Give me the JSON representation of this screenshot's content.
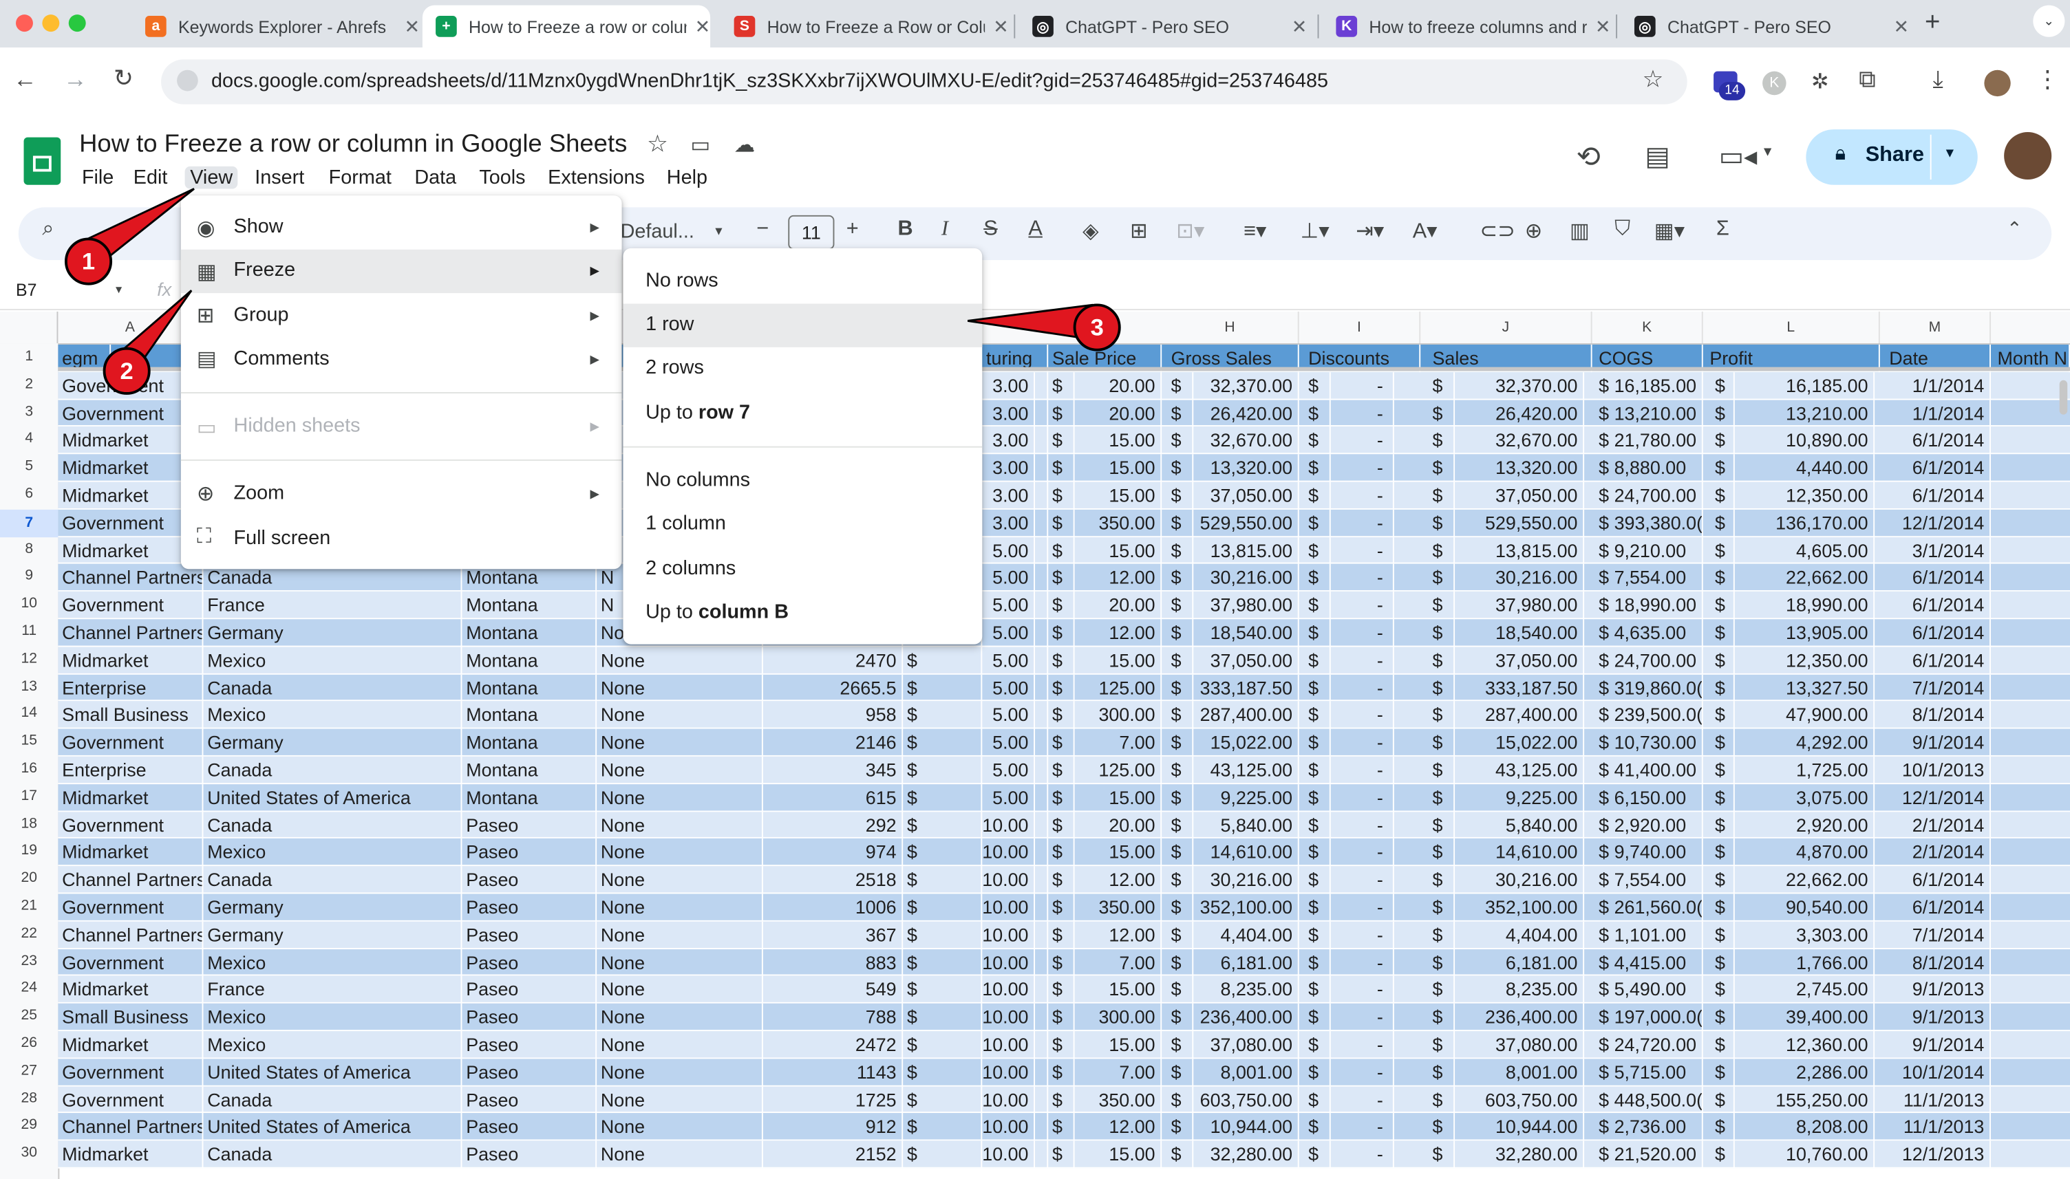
{
  "browser": {
    "tabs": [
      {
        "title": "Keywords Explorer - Ahrefs",
        "fav": "a",
        "fav_color": "#f26f21"
      },
      {
        "title": "How to Freeze a row or column",
        "fav": "+",
        "fav_color": "#0f9d58"
      },
      {
        "title": "How to Freeze a Row or Column",
        "fav": "S",
        "fav_color": "#e0352b"
      },
      {
        "title": "ChatGPT - Pero SEO",
        "fav": "◎",
        "fav_color": "#202124"
      },
      {
        "title": "How to freeze columns and rows",
        "fav": "K",
        "fav_color": "#6b3fd4"
      },
      {
        "title": "ChatGPT - Pero SEO",
        "fav": "◎",
        "fav_color": "#202124"
      }
    ],
    "url": "docs.google.com/spreadsheets/d/11Mznx0ygdWnenDhr1tjK_sz3SKXxbr7ijXWOUlMXU-E/edit?gid=253746485#gid=253746485",
    "extension_badge": "14"
  },
  "sheets": {
    "doc_title": "How to Freeze a row or column in Google Sheets",
    "menu": [
      "File",
      "Edit",
      "View",
      "Insert",
      "Format",
      "Data",
      "Tools",
      "Extensions",
      "Help"
    ],
    "share_label": "Share",
    "font_name": "Defaul...",
    "font_size": "11",
    "name_box": "B7",
    "fx": "fx"
  },
  "view_menu": {
    "items": [
      "Show",
      "Freeze",
      "Group",
      "Comments",
      "Hidden sheets",
      "Zoom",
      "Full screen"
    ]
  },
  "freeze_submenu": {
    "rows": [
      "No rows",
      "1 row",
      "2 rows",
      "Up to"
    ],
    "row_bold": "row 7",
    "cols": [
      "No columns",
      "1 column",
      "2 columns",
      "Up to"
    ],
    "col_bold": "column B"
  },
  "annotations": [
    "1",
    "2",
    "3"
  ],
  "grid": {
    "columns": [
      "A",
      "H",
      "I",
      "J",
      "K",
      "L",
      "M"
    ],
    "header_row": [
      "egm",
      "turing",
      "Sale Price",
      "Gross Sales",
      "Discounts",
      "Sales",
      "COGS",
      "Profit",
      "Date",
      "Month N"
    ],
    "rows": [
      {
        "n": "1"
      },
      {
        "n": "2",
        "seg": "Government",
        "country": "",
        "product": "",
        "disc": "",
        "units": "",
        "mfg": "3.00",
        "price": "20.00",
        "gross": "32,370.00",
        "sales": "32,370.00",
        "cogs": "$ 16,185.00",
        "profit": "16,185.00",
        "date": "1/1/2014"
      },
      {
        "n": "3",
        "seg": "Government",
        "country": "",
        "product": "",
        "disc": "",
        "units": "",
        "mfg": "3.00",
        "price": "20.00",
        "gross": "26,420.00",
        "sales": "26,420.00",
        "cogs": "$ 13,210.00",
        "profit": "13,210.00",
        "date": "1/1/2014"
      },
      {
        "n": "4",
        "seg": "Midmarket",
        "country": "",
        "product": "",
        "disc": "",
        "units": "",
        "mfg": "3.00",
        "price": "15.00",
        "gross": "32,670.00",
        "sales": "32,670.00",
        "cogs": "$ 21,780.00",
        "profit": "10,890.00",
        "date": "6/1/2014"
      },
      {
        "n": "5",
        "seg": "Midmarket",
        "country": "",
        "product": "",
        "disc": "",
        "units": "",
        "mfg": "3.00",
        "price": "15.00",
        "gross": "13,320.00",
        "sales": "13,320.00",
        "cogs": "$ 8,880.00",
        "profit": "4,440.00",
        "date": "6/1/2014"
      },
      {
        "n": "6",
        "seg": "Midmarket",
        "country": "",
        "product": "",
        "disc": "",
        "units": "",
        "mfg": "3.00",
        "price": "15.00",
        "gross": "37,050.00",
        "sales": "37,050.00",
        "cogs": "$ 24,700.00",
        "profit": "12,350.00",
        "date": "6/1/2014"
      },
      {
        "n": "7",
        "seg": "Government",
        "country": "",
        "product": "",
        "disc": "",
        "units": "",
        "mfg": "3.00",
        "price": "350.00",
        "gross": "529,550.00",
        "sales": "529,550.00",
        "cogs": "$ 393,380.0(",
        "profit": "136,170.00",
        "date": "12/1/2014"
      },
      {
        "n": "8",
        "seg": "Midmarket",
        "country": "",
        "product": "",
        "disc": "",
        "units": "",
        "mfg": "5.00",
        "price": "15.00",
        "gross": "13,815.00",
        "sales": "13,815.00",
        "cogs": "$ 9,210.00",
        "profit": "4,605.00",
        "date": "3/1/2014"
      },
      {
        "n": "9",
        "seg": "Channel Partners",
        "country": "Canada",
        "product": "Montana",
        "disc": "N",
        "units": "",
        "mfg": "5.00",
        "price": "12.00",
        "gross": "30,216.00",
        "sales": "30,216.00",
        "cogs": "$ 7,554.00",
        "profit": "22,662.00",
        "date": "6/1/2014"
      },
      {
        "n": "10",
        "seg": "Government",
        "country": "France",
        "product": "Montana",
        "disc": "N",
        "units": "",
        "mfg": "5.00",
        "price": "20.00",
        "gross": "37,980.00",
        "sales": "37,980.00",
        "cogs": "$ 18,990.00",
        "profit": "18,990.00",
        "date": "6/1/2014"
      },
      {
        "n": "11",
        "seg": "Channel Partners",
        "country": "Germany",
        "product": "Montana",
        "disc": "None",
        "units": "",
        "mfg": "5.00",
        "price": "12.00",
        "gross": "18,540.00",
        "sales": "18,540.00",
        "cogs": "$ 4,635.00",
        "profit": "13,905.00",
        "date": "6/1/2014"
      },
      {
        "n": "12",
        "seg": "Midmarket",
        "country": "Mexico",
        "product": "Montana",
        "disc": "None",
        "units": "2470",
        "mfg": "5.00",
        "price": "15.00",
        "gross": "37,050.00",
        "sales": "37,050.00",
        "cogs": "$ 24,700.00",
        "profit": "12,350.00",
        "date": "6/1/2014"
      },
      {
        "n": "13",
        "seg": "Enterprise",
        "country": "Canada",
        "product": "Montana",
        "disc": "None",
        "units": "2665.5",
        "mfg": "5.00",
        "price": "125.00",
        "gross": "333,187.50",
        "sales": "333,187.50",
        "cogs": "$ 319,860.0(",
        "profit": "13,327.50",
        "date": "7/1/2014"
      },
      {
        "n": "14",
        "seg": "Small Business",
        "country": "Mexico",
        "product": "Montana",
        "disc": "None",
        "units": "958",
        "mfg": "5.00",
        "price": "300.00",
        "gross": "287,400.00",
        "sales": "287,400.00",
        "cogs": "$ 239,500.0(",
        "profit": "47,900.00",
        "date": "8/1/2014"
      },
      {
        "n": "15",
        "seg": "Government",
        "country": "Germany",
        "product": "Montana",
        "disc": "None",
        "units": "2146",
        "mfg": "5.00",
        "price": "7.00",
        "gross": "15,022.00",
        "sales": "15,022.00",
        "cogs": "$ 10,730.00",
        "profit": "4,292.00",
        "date": "9/1/2014"
      },
      {
        "n": "16",
        "seg": "Enterprise",
        "country": "Canada",
        "product": "Montana",
        "disc": "None",
        "units": "345",
        "mfg": "5.00",
        "price": "125.00",
        "gross": "43,125.00",
        "sales": "43,125.00",
        "cogs": "$ 41,400.00",
        "profit": "1,725.00",
        "date": "10/1/2013"
      },
      {
        "n": "17",
        "seg": "Midmarket",
        "country": "United States of America",
        "product": "Montana",
        "disc": "None",
        "units": "615",
        "mfg": "5.00",
        "price": "15.00",
        "gross": "9,225.00",
        "sales": "9,225.00",
        "cogs": "$ 6,150.00",
        "profit": "3,075.00",
        "date": "12/1/2014"
      },
      {
        "n": "18",
        "seg": "Government",
        "country": "Canada",
        "product": "Paseo",
        "disc": "None",
        "units": "292",
        "mfg": "10.00",
        "price": "20.00",
        "gross": "5,840.00",
        "sales": "5,840.00",
        "cogs": "$ 2,920.00",
        "profit": "2,920.00",
        "date": "2/1/2014"
      },
      {
        "n": "19",
        "seg": "Midmarket",
        "country": "Mexico",
        "product": "Paseo",
        "disc": "None",
        "units": "974",
        "mfg": "10.00",
        "price": "15.00",
        "gross": "14,610.00",
        "sales": "14,610.00",
        "cogs": "$ 9,740.00",
        "profit": "4,870.00",
        "date": "2/1/2014"
      },
      {
        "n": "20",
        "seg": "Channel Partners",
        "country": "Canada",
        "product": "Paseo",
        "disc": "None",
        "units": "2518",
        "mfg": "10.00",
        "price": "12.00",
        "gross": "30,216.00",
        "sales": "30,216.00",
        "cogs": "$ 7,554.00",
        "profit": "22,662.00",
        "date": "6/1/2014"
      },
      {
        "n": "21",
        "seg": "Government",
        "country": "Germany",
        "product": "Paseo",
        "disc": "None",
        "units": "1006",
        "mfg": "10.00",
        "price": "350.00",
        "gross": "352,100.00",
        "sales": "352,100.00",
        "cogs": "$ 261,560.0(",
        "profit": "90,540.00",
        "date": "6/1/2014"
      },
      {
        "n": "22",
        "seg": "Channel Partners",
        "country": "Germany",
        "product": "Paseo",
        "disc": "None",
        "units": "367",
        "mfg": "10.00",
        "price": "12.00",
        "gross": "4,404.00",
        "sales": "4,404.00",
        "cogs": "$ 1,101.00",
        "profit": "3,303.00",
        "date": "7/1/2014"
      },
      {
        "n": "23",
        "seg": "Government",
        "country": "Mexico",
        "product": "Paseo",
        "disc": "None",
        "units": "883",
        "mfg": "10.00",
        "price": "7.00",
        "gross": "6,181.00",
        "sales": "6,181.00",
        "cogs": "$ 4,415.00",
        "profit": "1,766.00",
        "date": "8/1/2014"
      },
      {
        "n": "24",
        "seg": "Midmarket",
        "country": "France",
        "product": "Paseo",
        "disc": "None",
        "units": "549",
        "mfg": "10.00",
        "price": "15.00",
        "gross": "8,235.00",
        "sales": "8,235.00",
        "cogs": "$ 5,490.00",
        "profit": "2,745.00",
        "date": "9/1/2013"
      },
      {
        "n": "25",
        "seg": "Small Business",
        "country": "Mexico",
        "product": "Paseo",
        "disc": "None",
        "units": "788",
        "mfg": "10.00",
        "price": "300.00",
        "gross": "236,400.00",
        "sales": "236,400.00",
        "cogs": "$ 197,000.0(",
        "profit": "39,400.00",
        "date": "9/1/2013"
      },
      {
        "n": "26",
        "seg": "Midmarket",
        "country": "Mexico",
        "product": "Paseo",
        "disc": "None",
        "units": "2472",
        "mfg": "10.00",
        "price": "15.00",
        "gross": "37,080.00",
        "sales": "37,080.00",
        "cogs": "$ 24,720.00",
        "profit": "12,360.00",
        "date": "9/1/2014"
      },
      {
        "n": "27",
        "seg": "Government",
        "country": "United States of America",
        "product": "Paseo",
        "disc": "None",
        "units": "1143",
        "mfg": "10.00",
        "price": "7.00",
        "gross": "8,001.00",
        "sales": "8,001.00",
        "cogs": "$ 5,715.00",
        "profit": "2,286.00",
        "date": "10/1/2014"
      },
      {
        "n": "28",
        "seg": "Government",
        "country": "Canada",
        "product": "Paseo",
        "disc": "None",
        "units": "1725",
        "mfg": "10.00",
        "price": "350.00",
        "gross": "603,750.00",
        "sales": "603,750.00",
        "cogs": "$ 448,500.0(",
        "profit": "155,250.00",
        "date": "11/1/2013"
      },
      {
        "n": "29",
        "seg": "Channel Partners",
        "country": "United States of America",
        "product": "Paseo",
        "disc": "None",
        "units": "912",
        "mfg": "10.00",
        "price": "12.00",
        "gross": "10,944.00",
        "sales": "10,944.00",
        "cogs": "$ 2,736.00",
        "profit": "8,208.00",
        "date": "11/1/2013"
      },
      {
        "n": "30",
        "seg": "Midmarket",
        "country": "Canada",
        "product": "Paseo",
        "disc": "None",
        "units": "2152",
        "mfg": "10.00",
        "price": "15.00",
        "gross": "32,280.00",
        "sales": "32,280.00",
        "cogs": "$ 21,520.00",
        "profit": "10,760.00",
        "date": "12/1/2013"
      }
    ],
    "dash": "-",
    "dollar": "$"
  },
  "colors": {
    "accent": "#0b57d0",
    "header_band": "#5b9bd5",
    "row_band_a": "#dce8f7",
    "row_band_b": "#bcd4ef",
    "annotation": "#e0161f"
  }
}
